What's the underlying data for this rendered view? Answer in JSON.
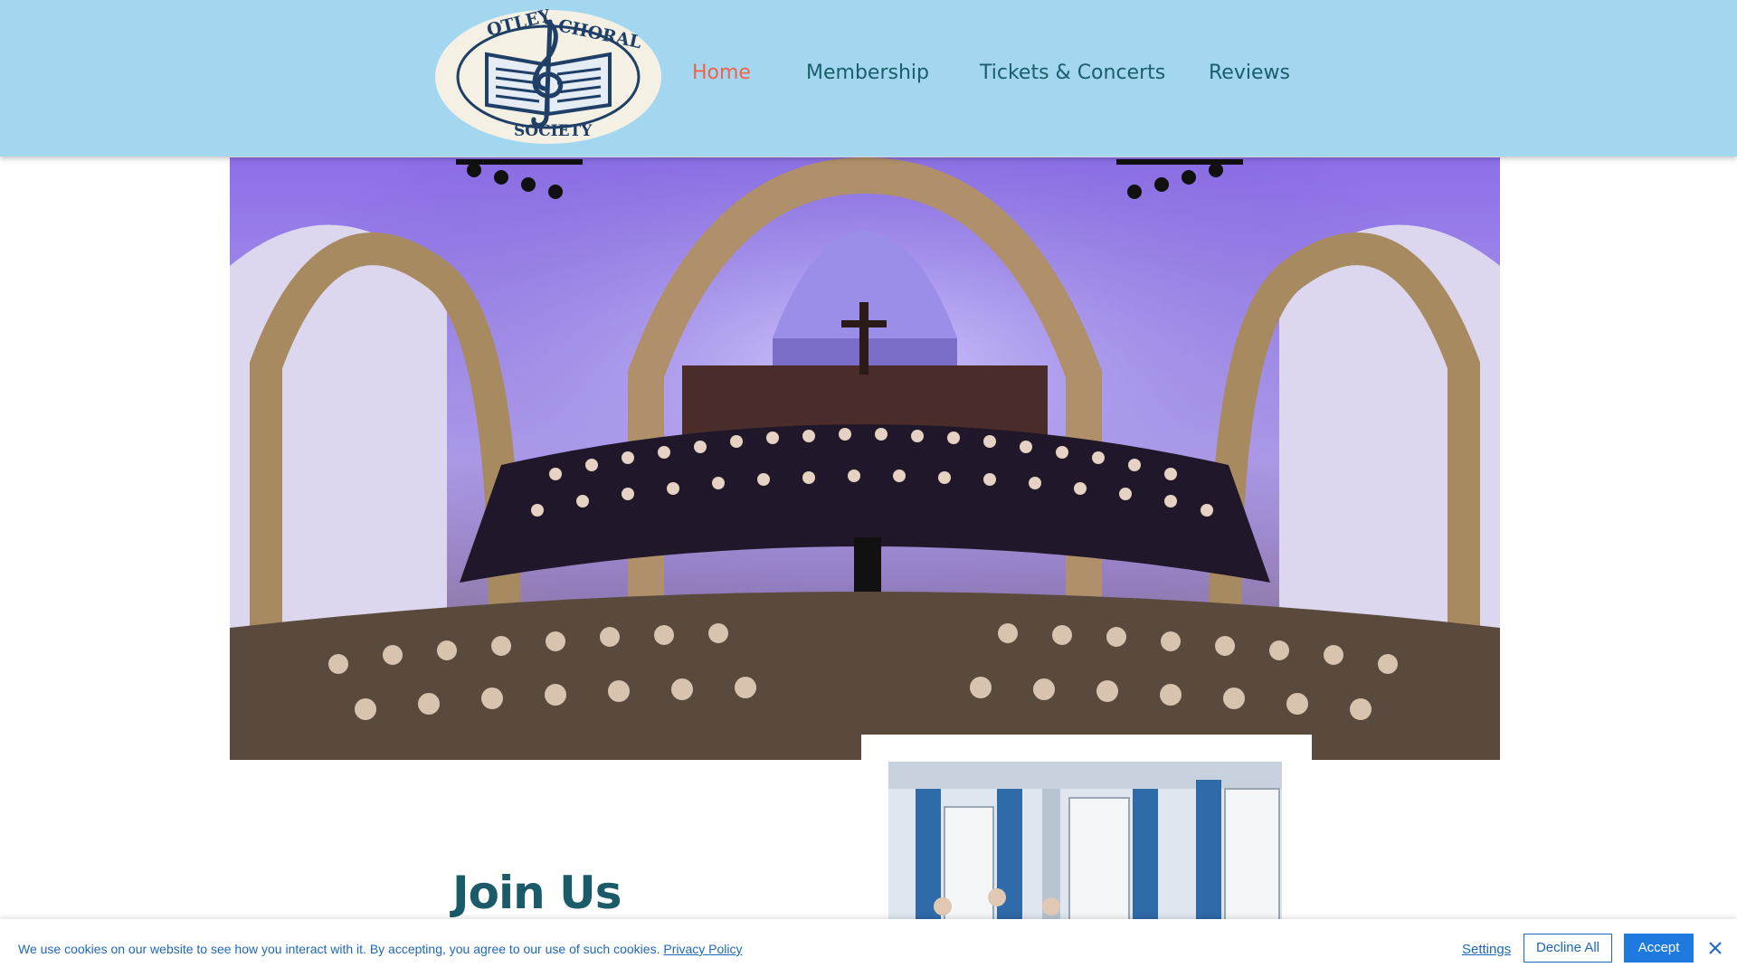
{
  "site": {
    "logo": {
      "text_top_left": "OTLEY",
      "text_top_right": "CHORAL",
      "text_bottom": "SOCIETY",
      "icon": "treble-clef-book-logo"
    }
  },
  "nav": {
    "items": [
      {
        "label": "Home",
        "active": true
      },
      {
        "label": "Membership",
        "active": false
      },
      {
        "label": "Tickets & Concerts",
        "active": false
      },
      {
        "label": "Reviews",
        "active": false
      }
    ]
  },
  "main": {
    "hero_image": "choir-concert-in-church-photo",
    "join_title": "Join Us",
    "secondary_image": "rehearsal-hall-photo"
  },
  "cookie": {
    "message": "We use cookies on our website to see how you interact with it. By accepting, you agree to our use of such cookies.",
    "privacy_link": "Privacy Policy",
    "settings_label": "Settings",
    "decline_label": "Decline All",
    "accept_label": "Accept",
    "close_icon": "close-icon"
  },
  "colors": {
    "header_bg": "#a3d6ef",
    "nav_text": "#1a5e6a",
    "nav_active": "#f0624c",
    "title": "#1b5a68",
    "link": "#1e67b8",
    "accept_bg": "#1f7ae0"
  }
}
